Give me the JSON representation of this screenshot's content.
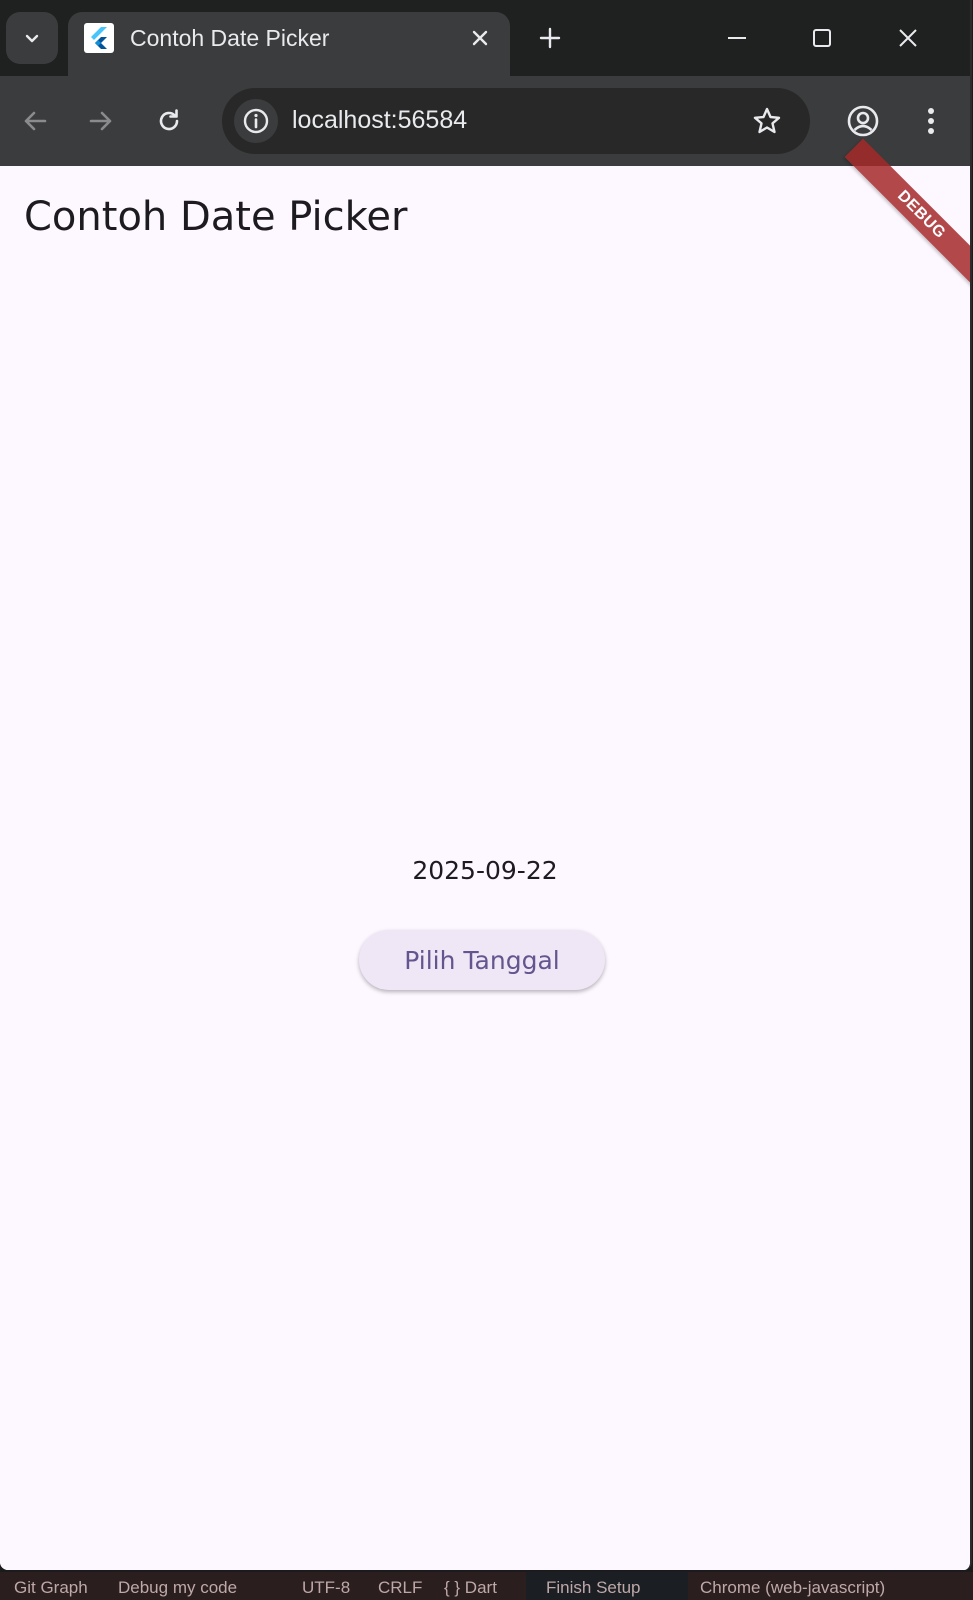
{
  "browser": {
    "tab": {
      "title": "Contoh Date Picker"
    },
    "address_bar": {
      "url": "localhost:56584"
    }
  },
  "app": {
    "title": "Contoh Date Picker",
    "debug_banner": "DEBUG",
    "selected_date": "2025-09-22",
    "pick_button_label": "Pilih Tanggal"
  },
  "status_bar": {
    "items": [
      "Git Graph",
      "Debug my code",
      "UTF-8",
      "CRLF",
      "{ } Dart",
      "Finish Setup",
      "Chrome (web-javascript)"
    ]
  },
  "colors": {
    "page_background": "#fdf7ff",
    "button_background": "#efe7f6",
    "button_text": "#65558f",
    "debug_banner": "#a52a2a"
  }
}
